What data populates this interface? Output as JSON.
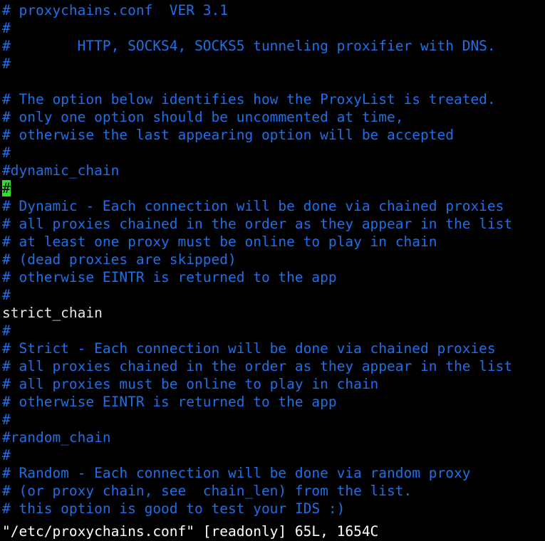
{
  "terminal": {
    "background_color": "#000000",
    "comment_color": "#1e6fe8",
    "normal_text_color": "#e6e6e6",
    "cursor_background_color": "#2ee02c",
    "cursor_foreground_color": "#000000",
    "columns": 62,
    "rows": 30
  },
  "editor": {
    "name": "vim",
    "cursor": {
      "line_index": 9,
      "column_index": 0,
      "character": "#"
    }
  },
  "buffer": {
    "lines": [
      {
        "text": "# proxychains.conf  VER 3.1",
        "style": "comment"
      },
      {
        "text": "#",
        "style": "comment"
      },
      {
        "text": "#        HTTP, SOCKS4, SOCKS5 tunneling proxifier with DNS.",
        "style": "comment"
      },
      {
        "text": "#",
        "style": "comment"
      },
      {
        "text": "",
        "style": "normal"
      },
      {
        "text": "# The option below identifies how the ProxyList is treated.",
        "style": "comment"
      },
      {
        "text": "# only one option should be uncommented at time,",
        "style": "comment"
      },
      {
        "text": "# otherwise the last appearing option will be accepted",
        "style": "comment"
      },
      {
        "text": "#",
        "style": "comment"
      },
      {
        "text": "#dynamic_chain",
        "style": "comment"
      },
      {
        "text": "#",
        "style": "comment",
        "cursor": true
      },
      {
        "text": "# Dynamic - Each connection will be done via chained proxies",
        "style": "comment"
      },
      {
        "text": "# all proxies chained in the order as they appear in the list",
        "style": "comment"
      },
      {
        "text": "# at least one proxy must be online to play in chain",
        "style": "comment"
      },
      {
        "text": "# (dead proxies are skipped)",
        "style": "comment"
      },
      {
        "text": "# otherwise EINTR is returned to the app",
        "style": "comment"
      },
      {
        "text": "#",
        "style": "comment"
      },
      {
        "text": "strict_chain",
        "style": "normal"
      },
      {
        "text": "#",
        "style": "comment"
      },
      {
        "text": "# Strict - Each connection will be done via chained proxies",
        "style": "comment"
      },
      {
        "text": "# all proxies chained in the order as they appear in the list",
        "style": "comment"
      },
      {
        "text": "# all proxies must be online to play in chain",
        "style": "comment"
      },
      {
        "text": "# otherwise EINTR is returned to the app",
        "style": "comment"
      },
      {
        "text": "#",
        "style": "comment"
      },
      {
        "text": "#random_chain",
        "style": "comment"
      },
      {
        "text": "#",
        "style": "comment"
      },
      {
        "text": "# Random - Each connection will be done via random proxy",
        "style": "comment"
      },
      {
        "text": "# (or proxy chain, see  chain_len) from the list.",
        "style": "comment"
      },
      {
        "text": "# this option is good to test your IDS :)",
        "style": "comment"
      }
    ]
  },
  "statusline": {
    "text": "\"/etc/proxychains.conf\" [readonly] 65L, 1654C",
    "file_path": "/etc/proxychains.conf",
    "mode_flag": "[readonly]",
    "line_count": "65L",
    "char_count": "1654C"
  }
}
